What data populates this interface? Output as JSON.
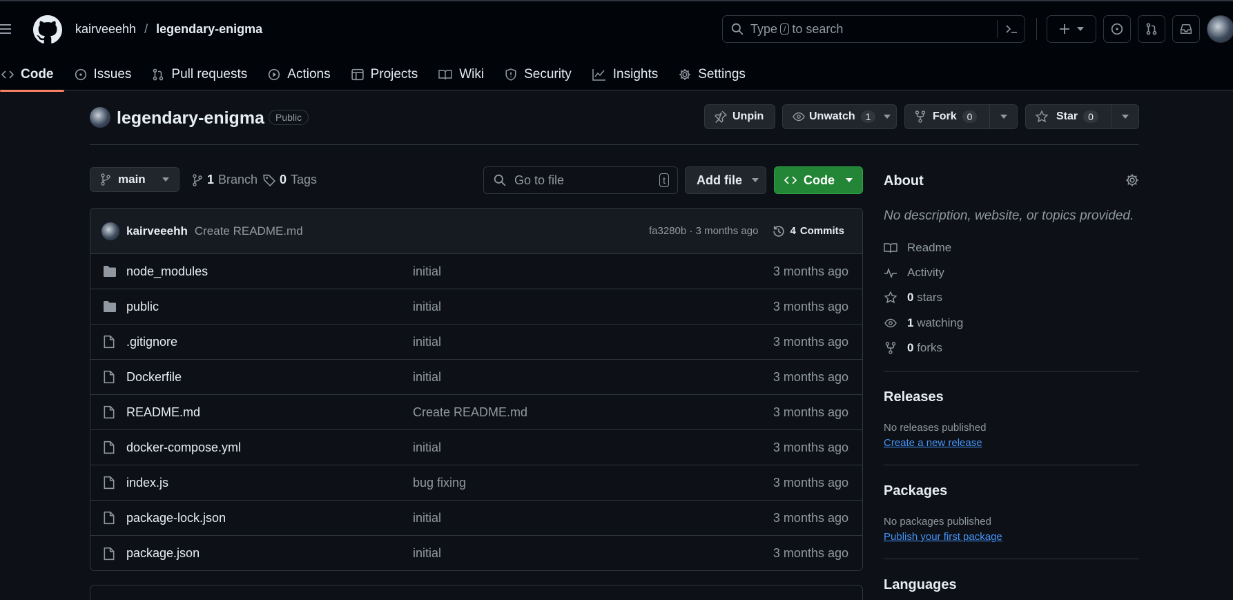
{
  "breadcrumb": {
    "owner": "kairveeehh",
    "separator": "/",
    "repo": "legendary-enigma"
  },
  "search": {
    "text_before": "Type",
    "key": "/",
    "text_after": "to search"
  },
  "nav_tabs": [
    {
      "label": "Code",
      "icon": "code-icon"
    },
    {
      "label": "Issues",
      "icon": "issue-icon"
    },
    {
      "label": "Pull requests",
      "icon": "pull-request-icon"
    },
    {
      "label": "Actions",
      "icon": "play-icon"
    },
    {
      "label": "Projects",
      "icon": "table-icon"
    },
    {
      "label": "Wiki",
      "icon": "book-icon"
    },
    {
      "label": "Security",
      "icon": "shield-icon"
    },
    {
      "label": "Insights",
      "icon": "graph-icon"
    },
    {
      "label": "Settings",
      "icon": "gear-icon"
    }
  ],
  "repo_header": {
    "name": "legendary-enigma",
    "visibility": "Public",
    "unpin_label": "Unpin",
    "unwatch_label": "Unwatch",
    "watch_count": "1",
    "fork_label": "Fork",
    "fork_count": "0",
    "star_label": "Star",
    "star_count": "0"
  },
  "toolbar": {
    "branch": "main",
    "branch_count": "1",
    "branch_label": "Branch",
    "tag_count": "0",
    "tag_label": "Tags",
    "goto_placeholder": "Go to file",
    "goto_key": "t",
    "add_file_label": "Add file",
    "code_label": "Code"
  },
  "latest_commit": {
    "author": "kairveeehh",
    "message": "Create README.md",
    "hash_time": "fa3280b · 3 months ago",
    "commits_count": "4",
    "commits_label": "Commits"
  },
  "files": [
    {
      "name": "node_modules",
      "type": "folder",
      "message": "initial",
      "age": "3 months ago"
    },
    {
      "name": "public",
      "type": "folder",
      "message": "initial",
      "age": "3 months ago"
    },
    {
      "name": ".gitignore",
      "type": "file",
      "message": "initial",
      "age": "3 months ago"
    },
    {
      "name": "Dockerfile",
      "type": "file",
      "message": "initial",
      "age": "3 months ago"
    },
    {
      "name": "README.md",
      "type": "file",
      "message": "Create README.md",
      "age": "3 months ago"
    },
    {
      "name": "docker-compose.yml",
      "type": "file",
      "message": "initial",
      "age": "3 months ago"
    },
    {
      "name": "index.js",
      "type": "file",
      "message": "bug fixing",
      "age": "3 months ago"
    },
    {
      "name": "package-lock.json",
      "type": "file",
      "message": "initial",
      "age": "3 months ago"
    },
    {
      "name": "package.json",
      "type": "file",
      "message": "initial",
      "age": "3 months ago"
    }
  ],
  "about": {
    "title": "About",
    "description": "No description, website, or topics provided.",
    "readme": "Readme",
    "activity": "Activity",
    "stars_count": "0",
    "stars_label": "stars",
    "watching_count": "1",
    "watching_label": "watching",
    "forks_count": "0",
    "forks_label": "forks"
  },
  "releases": {
    "title": "Releases",
    "empty": "No releases published",
    "link": "Create a new release"
  },
  "packages": {
    "title": "Packages",
    "empty": "No packages published",
    "link": "Publish your first package"
  },
  "languages": {
    "title": "Languages"
  },
  "colors": {
    "accent_green": "#238636",
    "link_blue": "#4493f8",
    "tab_underline": "#f78166",
    "background": "#0d1117"
  }
}
